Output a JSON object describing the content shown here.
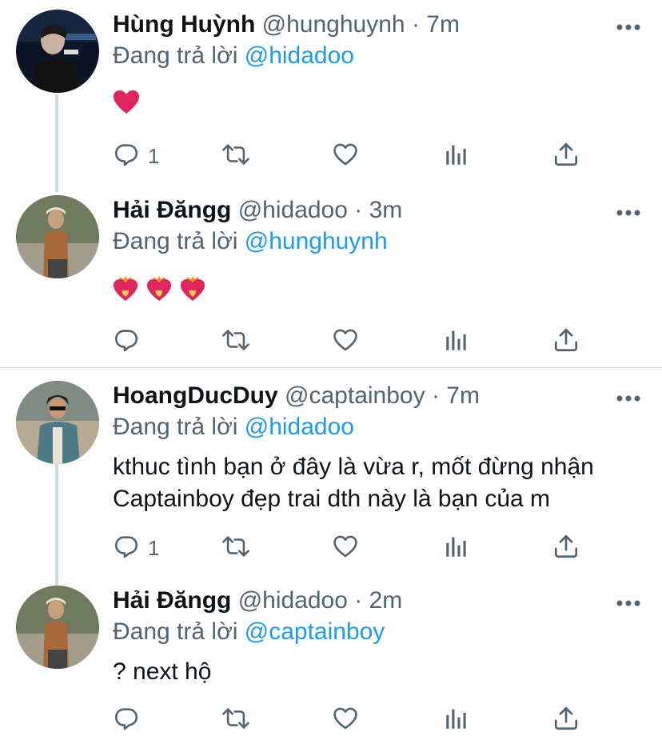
{
  "replying_label": "Đang trả lời",
  "tweets": [
    {
      "name": "Hùng Huỳnh",
      "handle": "@hunghuynh",
      "dot": "·",
      "time": "7m",
      "replying_to": "@hidadoo",
      "body": "",
      "emoji": [
        "❤️"
      ],
      "reply_count": "1"
    },
    {
      "name": "Hải Đăngg",
      "handle": "@hidadoo",
      "dot": "·",
      "time": "3m",
      "replying_to": "@hunghuynh",
      "body": "",
      "emoji": [
        "❤️‍🔥",
        "❤️‍🔥",
        "❤️‍🔥"
      ],
      "reply_count": ""
    },
    {
      "name": "HoangDucDuy",
      "handle": "@captainboy",
      "dot": "·",
      "time": "7m",
      "replying_to": "@hidadoo",
      "body": "kthuc tình bạn ở đây là vừa r, mốt đừng nhận\nCaptainboy đẹp trai dth này là bạn của m",
      "emoji": [],
      "reply_count": "1"
    },
    {
      "name": "Hải Đăngg",
      "handle": "@hidadoo",
      "dot": "·",
      "time": "2m",
      "replying_to": "@captainboy",
      "body": "? next hộ",
      "emoji": [],
      "reply_count": ""
    }
  ],
  "icons": {
    "reply": "reply-icon",
    "retweet": "retweet-icon",
    "like": "heart-icon",
    "analytics": "analytics-icon",
    "share": "share-icon",
    "more": "more-icon"
  },
  "colors": {
    "text": "#0f1419",
    "secondary": "#536471",
    "accent": "#1d9bf0",
    "heart": "#e0245e",
    "divider": "#cfd9de"
  }
}
